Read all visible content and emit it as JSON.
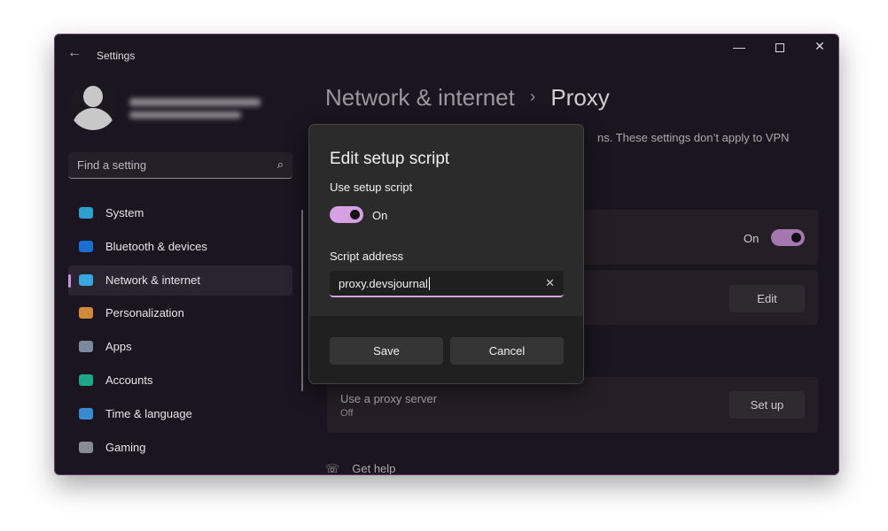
{
  "window": {
    "title": "Settings",
    "controls": [
      "minimize",
      "maximize",
      "close"
    ]
  },
  "search": {
    "placeholder": "Find a setting"
  },
  "sidebar": {
    "items": [
      {
        "label": "System",
        "icon": "monitor-icon",
        "color": "#2f9fd0"
      },
      {
        "label": "Bluetooth & devices",
        "icon": "bluetooth-icon",
        "color": "#1b6fd0"
      },
      {
        "label": "Network & internet",
        "icon": "wifi-icon",
        "color": "#3aa8e0",
        "selected": true
      },
      {
        "label": "Personalization",
        "icon": "brush-icon",
        "color": "#d08a3a"
      },
      {
        "label": "Apps",
        "icon": "apps-icon",
        "color": "#7a8a9a"
      },
      {
        "label": "Accounts",
        "icon": "person-icon",
        "color": "#1fa58a"
      },
      {
        "label": "Time & language",
        "icon": "clock-globe-icon",
        "color": "#3a8ad0"
      },
      {
        "label": "Gaming",
        "icon": "gamepad-icon",
        "color": "#8a8a95"
      }
    ]
  },
  "header": {
    "parent": "Network & internet",
    "separator": "›",
    "current": "Proxy"
  },
  "main": {
    "description": "ns. These settings don’t apply to VPN",
    "auto_script_state": "On",
    "edit_label": "Edit",
    "manual": {
      "title": "Use a proxy server",
      "state": "Off",
      "button": "Set up"
    },
    "help": "Get help"
  },
  "dialog": {
    "title": "Edit setup script",
    "toggle_label": "Use setup script",
    "toggle_state": "On",
    "address_label": "Script address",
    "address_value": "proxy.devsjournal",
    "save": "Save",
    "cancel": "Cancel"
  },
  "colors": {
    "accent": "#d7a0e3"
  }
}
